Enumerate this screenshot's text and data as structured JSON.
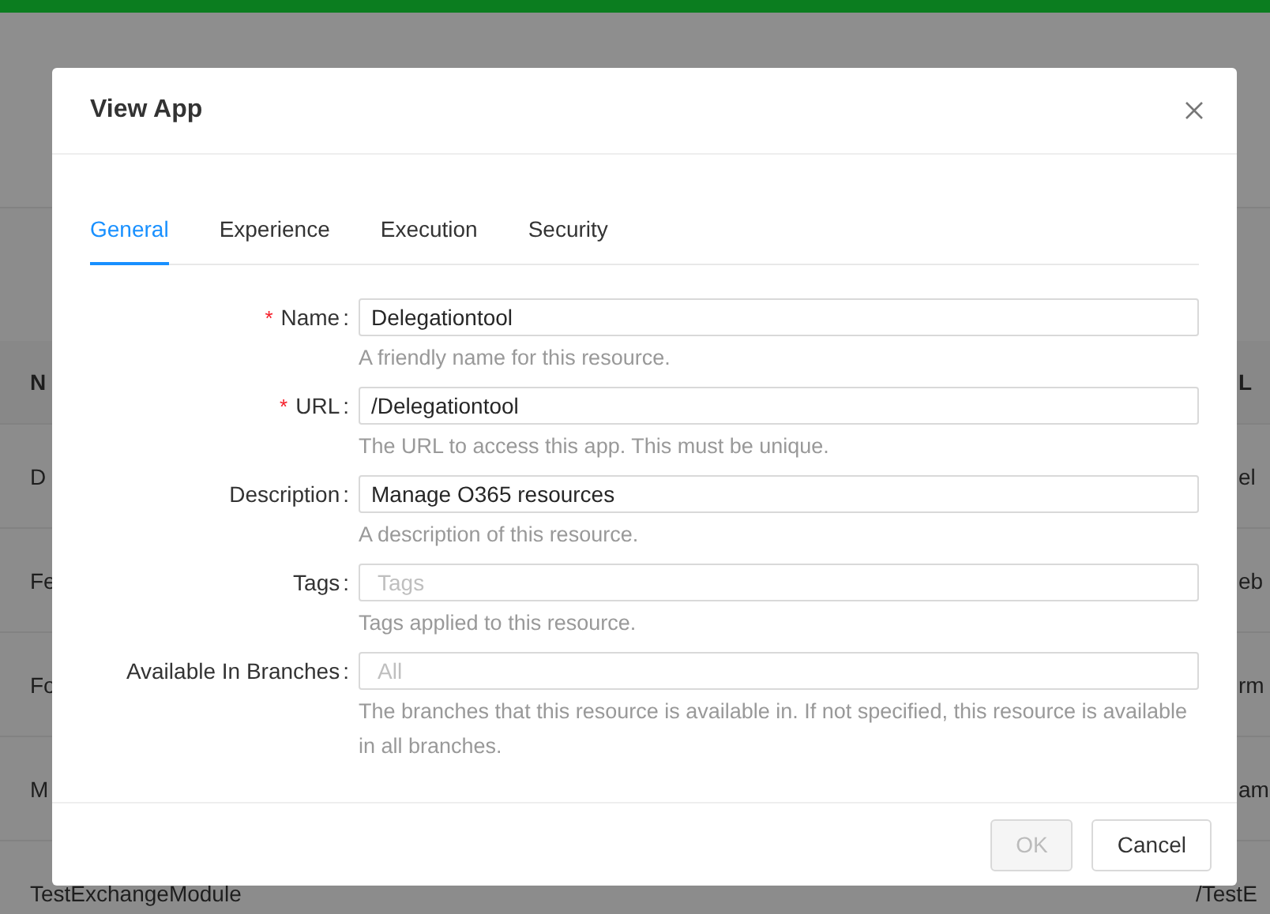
{
  "background_table": {
    "columns": [
      "N",
      "L"
    ],
    "rows": [
      {
        "column_1": "D",
        "column_2": "el",
        "covered": true
      },
      {
        "column_1": "Fe",
        "column_2": "eb",
        "covered": true
      },
      {
        "column_1": "Fo",
        "column_2": "rm",
        "covered": true
      },
      {
        "column_1": "M",
        "column_2": "am",
        "covered": true
      },
      {
        "column_1": "TestExchangeModule",
        "column_2": "/TestE",
        "covered": false
      }
    ]
  },
  "dialog": {
    "title": "View App",
    "tabs": [
      {
        "label": "General",
        "selected": true
      },
      {
        "label": "Experience",
        "selected": false
      },
      {
        "label": "Execution",
        "selected": false
      },
      {
        "label": "Security",
        "selected": false
      }
    ],
    "fields": [
      {
        "required_mark": "*",
        "label": "Name",
        "colon": ":",
        "value": "Delegationtool",
        "help": "A friendly name for this resource."
      },
      {
        "required_mark": "*",
        "label": "URL",
        "colon": ":",
        "value": "/Delegationtool",
        "help": "The URL to access this app. This must be unique."
      },
      {
        "label": "Description",
        "colon": ":",
        "value": "Manage O365 resources",
        "help": "A description of this resource."
      },
      {
        "label": "Tags",
        "colon": ":",
        "placeholder": "Tags",
        "help": "Tags applied to this resource."
      },
      {
        "label": "Available In Branches",
        "colon": ":",
        "placeholder": "All",
        "help": "The branches that this resource is available in. If not specified, this resource is available in all branches."
      }
    ],
    "buttons": [
      {
        "label": "OK",
        "disabled": true
      },
      {
        "label": "Cancel",
        "disabled": false
      }
    ]
  }
}
